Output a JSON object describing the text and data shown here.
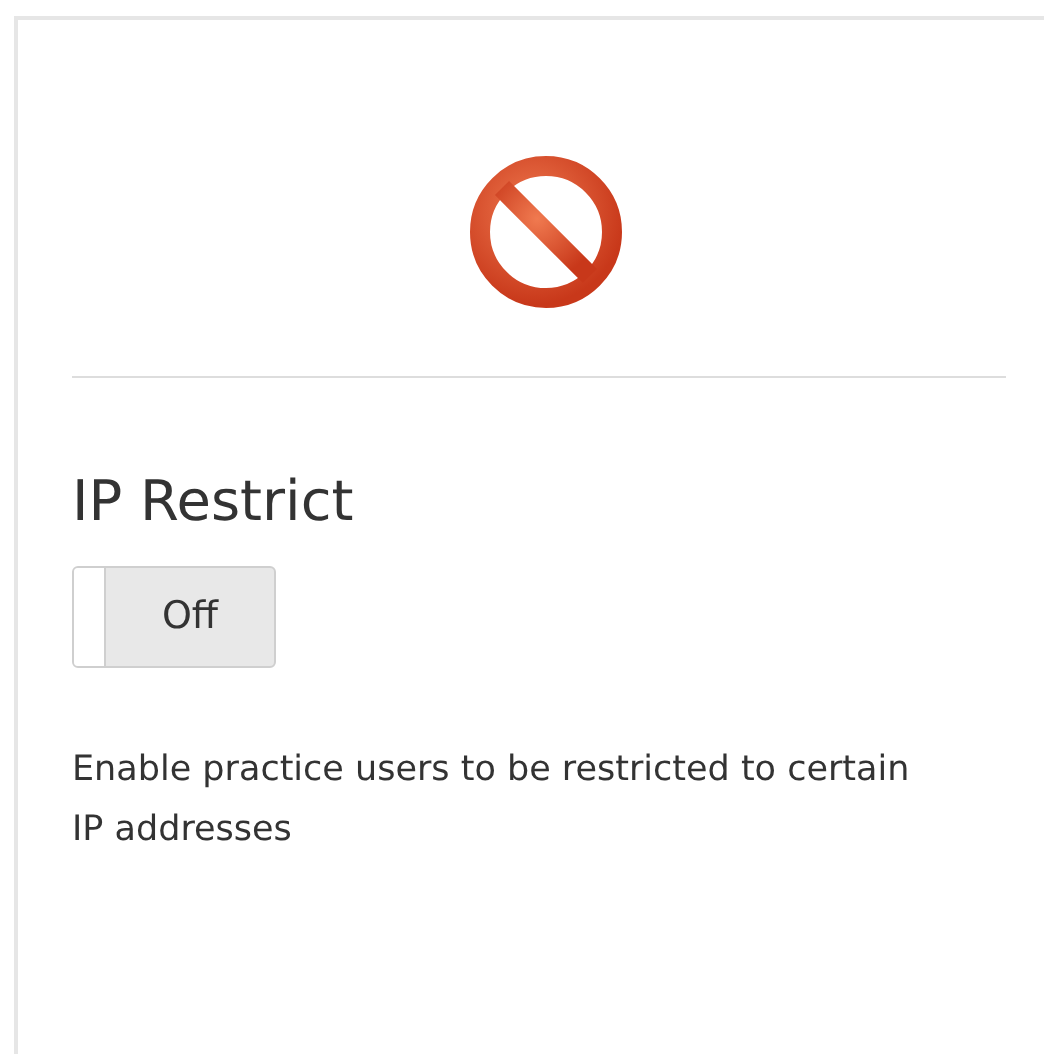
{
  "setting": {
    "title": "IP Restrict",
    "toggle": {
      "on": false,
      "label": "Off"
    },
    "description": "Enable practice users to be restricted to certain IP addresses"
  }
}
